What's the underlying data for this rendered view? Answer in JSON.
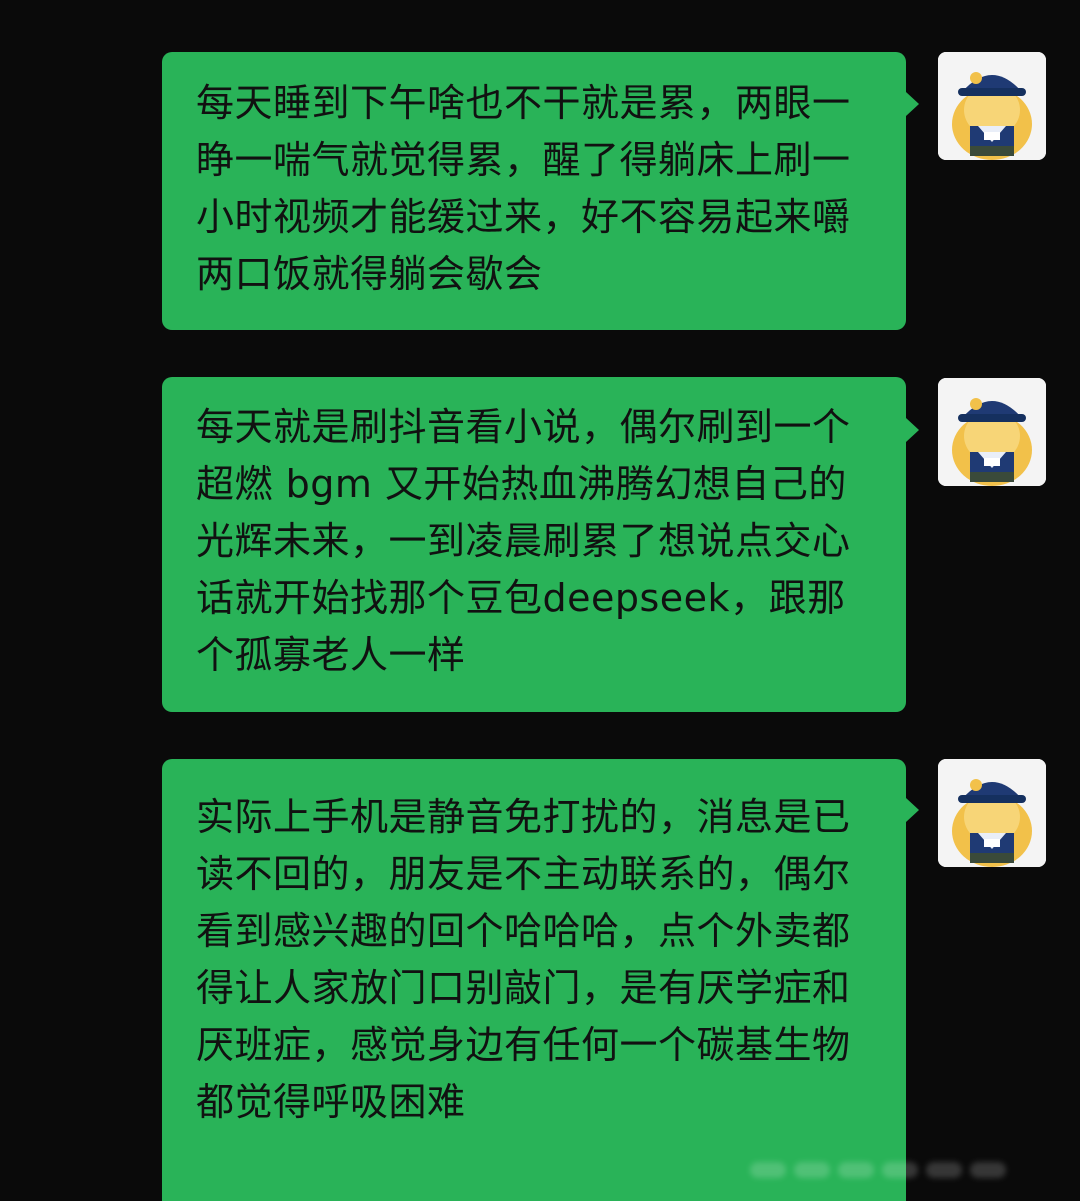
{
  "chat": {
    "messages": [
      {
        "text": "每天睡到下午啥也不干就是累，两眼一睁一喘气就觉得累，醒了得躺床上刷一小时视频才能缓过来，好不容易起来嚼两口饭就得躺会歇会"
      },
      {
        "text": "每天就是刷抖音看小说，偶尔刷到一个超燃 bgm 又开始热血沸腾幻想自己的光辉未来，一到凌晨刷累了想说点交心话就开始找那个豆包deepseek，跟那个孤寡老人一样"
      },
      {
        "text": "实际上手机是静音免打扰的，消息是已读不回的，朋友是不主动联系的，偶尔看到感兴趣的回个哈哈哈，点个外卖都得让人家放门口别敲门，是有厌学症和厌班症，感觉身边有任何一个碳基生物都觉得呼吸困难"
      }
    ],
    "colors": {
      "background": "#0a0a0a",
      "bubble": "#29b358",
      "text": "#111111"
    }
  }
}
